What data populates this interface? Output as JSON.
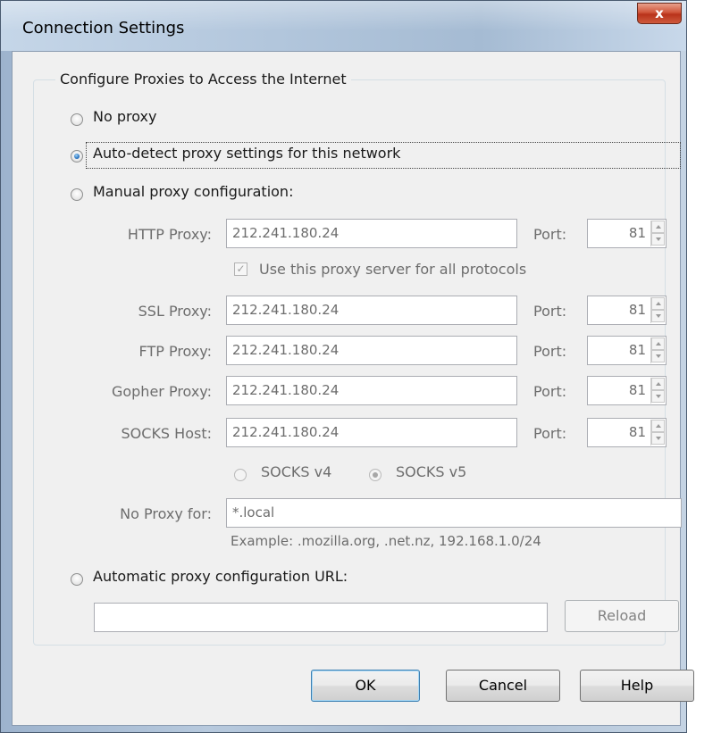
{
  "window": {
    "title": "Connection Settings",
    "close": "x"
  },
  "group": {
    "legend": "Configure Proxies to Access the Internet"
  },
  "options": {
    "no_proxy": "No proxy",
    "auto_detect": "Auto-detect proxy settings for this network",
    "manual": "Manual proxy configuration:",
    "auto_url": "Automatic proxy configuration URL:",
    "selected": "auto_detect"
  },
  "manual": {
    "http": {
      "label": "HTTP Proxy:",
      "value": "212.241.180.24",
      "port_label": "Port:",
      "port": "81"
    },
    "share_all": {
      "label": "Use this proxy server for all protocols",
      "checked": true
    },
    "ssl": {
      "label": "SSL Proxy:",
      "value": "212.241.180.24",
      "port_label": "Port:",
      "port": "81"
    },
    "ftp": {
      "label": "FTP Proxy:",
      "value": "212.241.180.24",
      "port_label": "Port:",
      "port": "81"
    },
    "gopher": {
      "label": "Gopher Proxy:",
      "value": "212.241.180.24",
      "port_label": "Port:",
      "port": "81"
    },
    "socks": {
      "label": "SOCKS Host:",
      "value": "212.241.180.24",
      "port_label": "Port:",
      "port": "81"
    },
    "socks_v4": "SOCKS v4",
    "socks_v5": "SOCKS v5",
    "socks_selected": "v5",
    "no_proxy_for": {
      "label": "No Proxy for:",
      "value": "*.local"
    },
    "example": "Example: .mozilla.org, .net.nz, 192.168.1.0/24"
  },
  "auto_url": {
    "value": "",
    "reload": "Reload"
  },
  "buttons": {
    "ok": "OK",
    "cancel": "Cancel",
    "help": "Help"
  },
  "icons": {
    "close": "close-icon",
    "spin_up": "spin-up-icon",
    "spin_down": "spin-down-icon",
    "check": "checkmark-icon"
  }
}
